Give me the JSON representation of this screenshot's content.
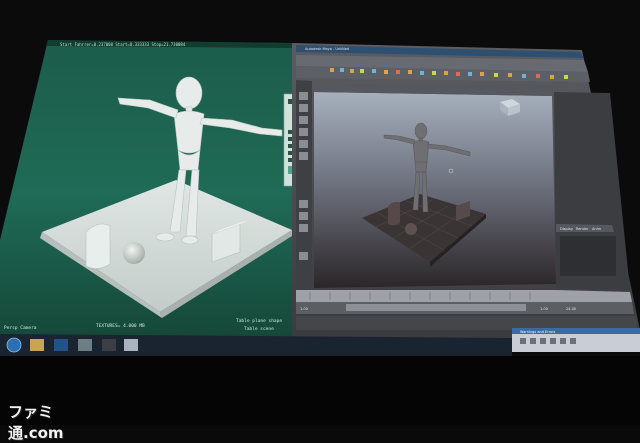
{
  "left_viewport": {
    "header": "Start Fahrrer=0.237000 Start=0.333333 Stop=21.730084",
    "camera": "Persp Camera",
    "textures": "TEXTURES= 4.000 MB",
    "shape_info": "Table plane shape",
    "scene_info": "Table scene"
  },
  "right_app": {
    "title": "Autodesk Maya - Untitled",
    "timeline_start": "1.00",
    "timeline_end": "1.00",
    "anim_end": "24.00",
    "tabs": [
      "Display",
      "Render",
      "Anim"
    ],
    "popup_title": "Warnings and Errors"
  },
  "taskbar": {
    "start_icon": "windows-start-icon"
  },
  "watermark": "ファミ通.com",
  "colors": {
    "left_bg": "#1f6a56",
    "maya_bg": "#4b4d52",
    "viewport_top": "#9aa3b0",
    "viewport_bottom": "#2c2a2c"
  }
}
